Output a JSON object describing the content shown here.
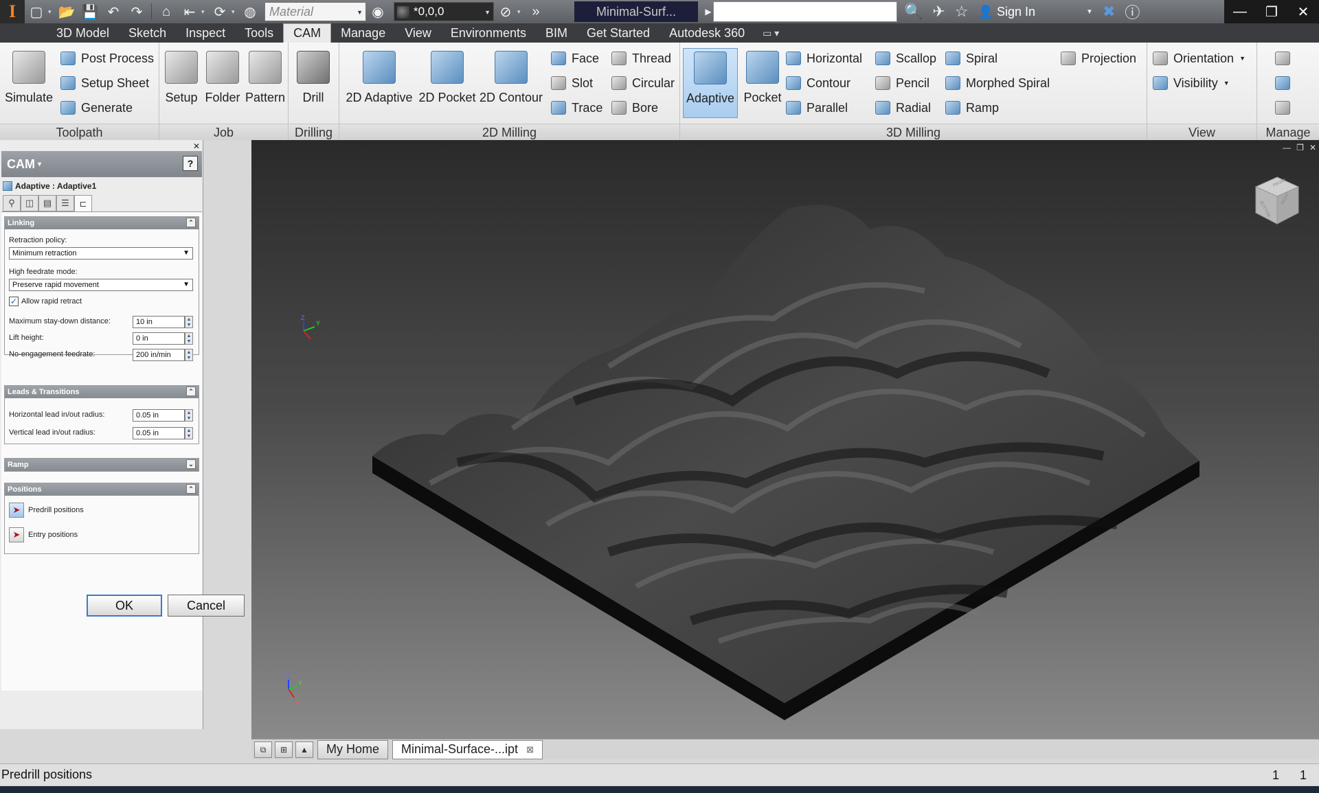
{
  "window": {
    "document_title": "Minimal-Surf...",
    "sign_in": "Sign In",
    "material_placeholder": "Material",
    "appearance_value": "*0,0,0"
  },
  "ribbon_tabs": [
    "3D Model",
    "Sketch",
    "Inspect",
    "Tools",
    "CAM",
    "Manage",
    "View",
    "Environments",
    "BIM",
    "Get Started",
    "Autodesk 360"
  ],
  "active_tab": "CAM",
  "ribbon": {
    "toolpath": {
      "label": "Toolpath",
      "simulate": "Simulate",
      "post_process": "Post Process",
      "setup_sheet": "Setup Sheet",
      "generate": "Generate"
    },
    "job": {
      "label": "Job",
      "setup": "Setup",
      "folder": "Folder",
      "pattern": "Pattern"
    },
    "drilling": {
      "label": "Drilling",
      "drill": "Drill"
    },
    "milling_2d": {
      "label": "2D Milling",
      "adaptive_2d": "2D Adaptive",
      "pocket_2d": "2D Pocket",
      "contour_2d": "2D Contour",
      "face": "Face",
      "slot": "Slot",
      "trace": "Trace",
      "thread": "Thread",
      "circular": "Circular",
      "bore": "Bore"
    },
    "milling_3d": {
      "label": "3D Milling",
      "adaptive": "Adaptive",
      "pocket": "Pocket",
      "horizontal": "Horizontal",
      "contour": "Contour",
      "parallel": "Parallel",
      "scallop": "Scallop",
      "pencil": "Pencil",
      "radial": "Radial",
      "spiral": "Spiral",
      "morphed_spiral": "Morphed Spiral",
      "ramp": "Ramp",
      "projection": "Projection"
    },
    "view": {
      "label": "View",
      "orientation": "Orientation",
      "visibility": "Visibility"
    },
    "manage": {
      "label": "Manage"
    }
  },
  "panel": {
    "title": "CAM",
    "operation": "Adaptive : Adaptive1",
    "linking": {
      "header": "Linking",
      "retraction_label": "Retraction policy:",
      "retraction_value": "Minimum retraction",
      "feedrate_mode_label": "High feedrate mode:",
      "feedrate_mode_value": "Preserve rapid movement",
      "allow_rapid": "Allow rapid retract",
      "allow_rapid_checked": true,
      "stay_down_label": "Maximum stay-down distance:",
      "stay_down_value": "10 in",
      "lift_label": "Lift height:",
      "lift_value": "0 in",
      "no_engage_label": "No-engagement feedrate:",
      "no_engage_value": "200 in/min"
    },
    "leads": {
      "header": "Leads & Transitions",
      "horizontal_label": "Horizontal lead in/out radius:",
      "horizontal_value": "0.05 in",
      "vertical_label": "Vertical lead in/out radius:",
      "vertical_value": "0.05 in"
    },
    "ramp": {
      "header": "Ramp"
    },
    "positions": {
      "header": "Positions",
      "predrill": "Predrill positions",
      "entry": "Entry positions"
    },
    "ok": "OK",
    "cancel": "Cancel"
  },
  "document_tabs": [
    "My Home",
    "Minimal-Surface-...ipt"
  ],
  "viewcube": {
    "face_top": "FRONT",
    "face_left": "BOTTOM",
    "face_right": "RIGHT"
  },
  "axes": {
    "x": "X",
    "y": "Y",
    "z": "Z"
  },
  "status": {
    "message": "Predrill positions",
    "count1": "1",
    "count2": "1"
  }
}
